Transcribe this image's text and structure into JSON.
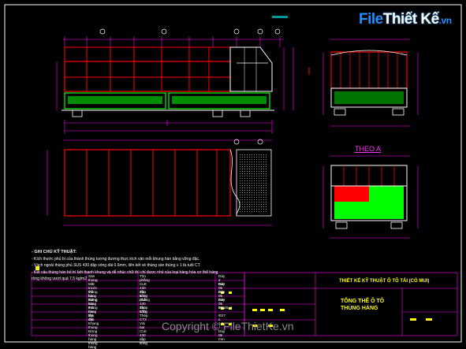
{
  "logo": {
    "part1": "File",
    "part2": "Thiết Kế",
    "part3": ".vn"
  },
  "watermark": "Copyright © FileThietKe.vn",
  "view_label": "THEO A",
  "notes": {
    "heading": "- GHI CHÚ KỸ THUẬT:",
    "lines": [
      "- Kích thước phủ bì của thành thùng tương đương thực kích vận mỗi khung hàn bằng vững đặc.",
      "- Vách ngoài thùng phủ SUS 430 dập sóng dài 0.6mm, liên kết vè thùng sàn thùng ≥ 1 tà tuổi CT.",
      "- Kết cấu thùng hàn bố trí bởi thanh khung và dễ nhúc chữ thì chỉ được nhỏ của loại hàng hóa cơ thể hàng",
      "  rồng không vượt quá 7,5 kg/m2"
    ]
  },
  "spec_rows": [
    {
      "a": "Sàn thùng",
      "b": "Tôn phẳng",
      "c": "Dày 2 mm"
    },
    {
      "a": "Mặt trước thùng hàng",
      "b": "CLE 430 dập sóng",
      "c": "Dày 05 mm"
    },
    {
      "a": "Vỏ bao thùng hàng",
      "b": "Tôn kẽm phẳng",
      "c": "Dày 05 mm"
    },
    {
      "a": "Bửng sau thùng hàng",
      "b": "CLE 430 dập sóng",
      "c": "Dày 05 mm"
    },
    {
      "a": "Mái mui lắp đặt",
      "b": "Thép CT3",
      "c": "50x25x1"
    },
    {
      "a": "Mái mui",
      "b": "Thép CT3",
      "c": "Φ27 x 1.8"
    },
    {
      "a": "Khung thùng",
      "b": "Vải bạt",
      "c": ""
    },
    {
      "a": "Bửng thùng hàng thùng hàng",
      "b": "CLE 430 dập sóng",
      "c": "Dày 05 mm"
    }
  ],
  "title_block": {
    "project": "THIẾT KẾ KỸ THUẬT Ô TÔ TẢI (CÓ MUI)",
    "drawing_line1": "TỔNG THỂ Ô TÔ",
    "drawing_line2": "THÙNG HÀNG"
  },
  "colors": {
    "red": "#ff0000",
    "green": "#00ff00",
    "white": "#ffffff",
    "magenta": "#ff00ff",
    "yellow": "#ffff00",
    "cyan": "#00ffff",
    "background": "#000000"
  }
}
